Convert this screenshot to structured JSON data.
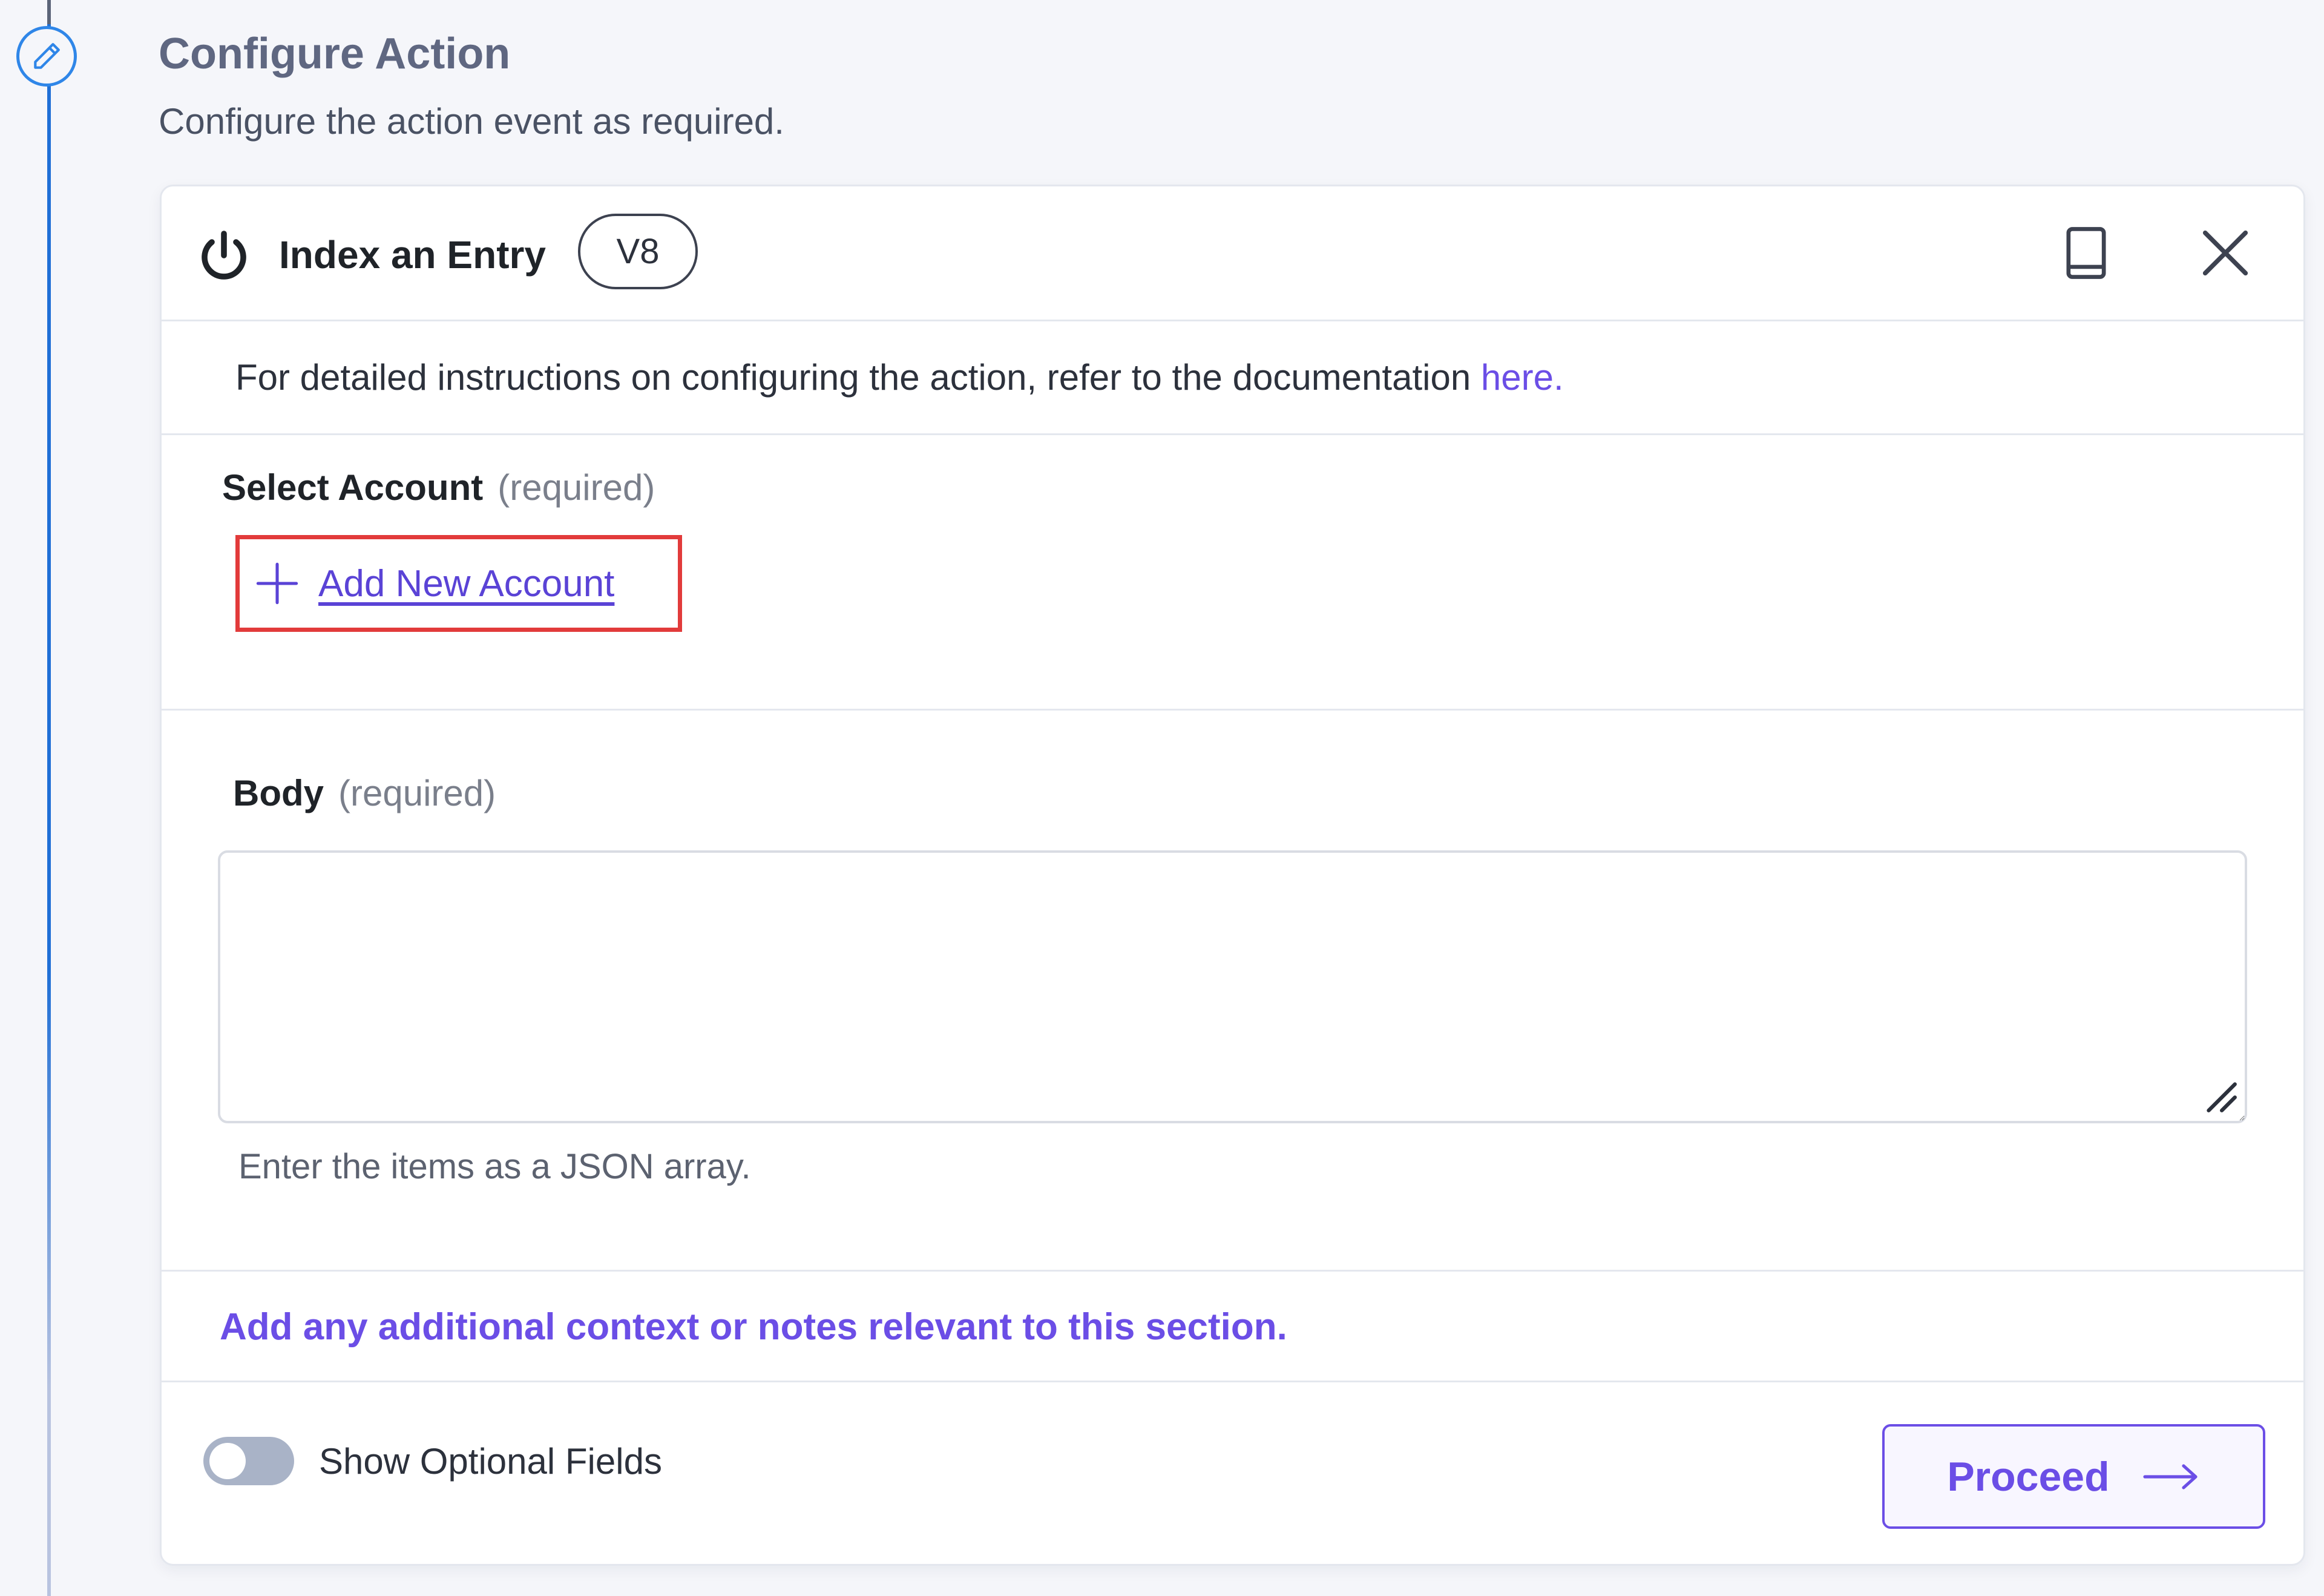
{
  "section": {
    "title": "Configure Action",
    "subtitle": "Configure the action event as required."
  },
  "card": {
    "action_name": "Index an Entry",
    "version": "V8",
    "header_icons": [
      "power-icon",
      "book-icon",
      "close-icon"
    ]
  },
  "instructions": {
    "text": "For detailed instructions on configuring the action, refer to the documentation ",
    "link_text": "here."
  },
  "account_field": {
    "label": "Select Account",
    "required": "(required)",
    "add_button_label": "Add New Account"
  },
  "body_field": {
    "label": "Body",
    "required": "(required)",
    "value": "",
    "helper": "Enter the items as a JSON array."
  },
  "notes": {
    "link_text": "Add any additional context or notes relevant to this section."
  },
  "footer": {
    "toggle_label": "Show Optional Fields",
    "toggle_on": false,
    "proceed_label": "Proceed"
  },
  "colors": {
    "accent": "#6b4ee6",
    "link": "#5a43d6",
    "timeline": "#1f6fd6",
    "highlight": "#e23b3b"
  }
}
